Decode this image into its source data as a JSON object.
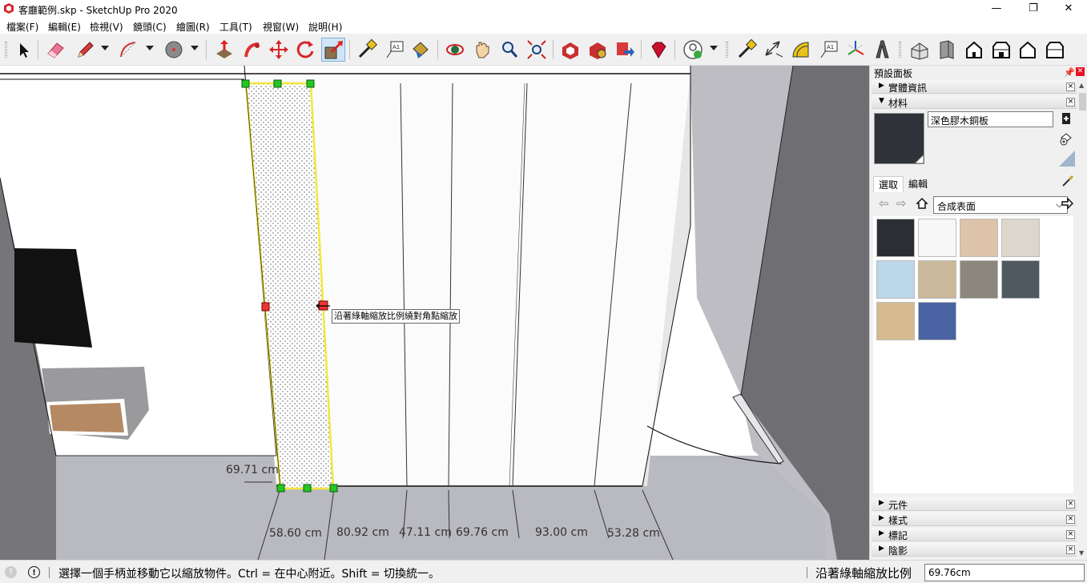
{
  "window": {
    "title": "客廳範例.skp - SketchUp Pro 2020",
    "minimize": "—",
    "maximize": "❐",
    "close": "✕"
  },
  "menu": [
    "檔案(F)",
    "編輯(E)",
    "檢視(V)",
    "鏡頭(C)",
    "繪圖(R)",
    "工具(T)",
    "視窗(W)",
    "說明(H)"
  ],
  "toolbar": {
    "tools": [
      "select",
      "eraser",
      "pencil-line",
      "arc",
      "circle",
      "push-pull",
      "follow-me",
      "move",
      "rotate",
      "scale",
      "tape-measure",
      "text",
      "paint-bucket",
      "orbit",
      "pan",
      "zoom",
      "zoom-extents",
      "warehouse",
      "extension-warehouse",
      "send-to-layout",
      "ruby",
      "account",
      "tape-measure-2",
      "dimensions",
      "protractor",
      "text-2",
      "axes",
      "3d-text",
      "iso-view",
      "front-view",
      "house-view",
      "right-view",
      "back-view",
      "left-view"
    ],
    "active_tool": "scale"
  },
  "viewport": {
    "tooltip": "沿著綠軸縮放比例繞對角點縮放",
    "dimensions": {
      "vertical": "69.71 cm",
      "d1": "58.60 cm",
      "d2": "80.92 cm",
      "d3": "47.11 cm",
      "d4": "69.76 cm",
      "d5": "93.00 cm",
      "d6": "53.28 cm"
    }
  },
  "panel": {
    "title": "預設面板",
    "pin": "📌",
    "close": "✕",
    "trays_top": [
      {
        "label": "實體資訊",
        "expanded": false
      },
      {
        "label": "材料",
        "expanded": true
      }
    ],
    "material": {
      "name": "深色膠木銅板",
      "preview_color": "#2f3339"
    },
    "tabs": {
      "select": "選取",
      "edit": "編輯"
    },
    "library": "合成表面",
    "swatches": [
      "#2b2f35",
      "#f7f7f8",
      "#dcc3a9",
      "#dcd7cc",
      "#bcd6ea",
      "#c9b89a",
      "#8b877c",
      "#4f5960",
      "#d5b98f",
      "#4a64a3"
    ],
    "trays_bottom": [
      {
        "label": "元件",
        "expanded": false
      },
      {
        "label": "樣式",
        "expanded": false
      },
      {
        "label": "標記",
        "expanded": false
      },
      {
        "label": "陰影",
        "expanded": false
      }
    ]
  },
  "status": {
    "message": "選擇一個手柄並移動它以縮放物件。Ctrl = 在中心附近。Shift = 切換統一。",
    "vcb_label": "沿著綠軸縮放比例",
    "vcb_value": "69.76cm"
  }
}
